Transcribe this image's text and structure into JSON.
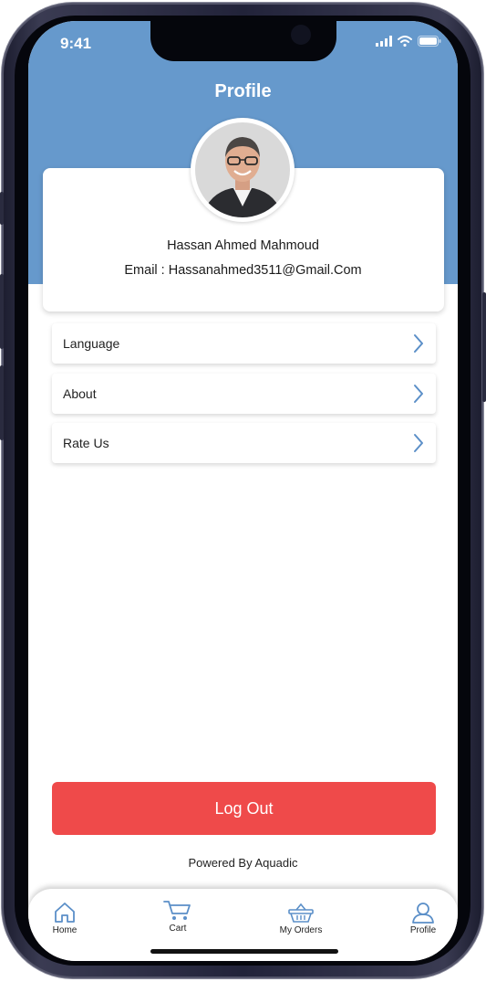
{
  "status_bar": {
    "time": "9:41"
  },
  "header": {
    "title": "Profile"
  },
  "profile": {
    "name": "Hassan Ahmed Mahmoud",
    "email_line": "Email : Hassanahmed3511@Gmail.Com"
  },
  "menu": [
    {
      "label": "Language",
      "icon": "chevron-right-icon"
    },
    {
      "label": "About",
      "icon": "chevron-right-icon"
    },
    {
      "label": "Rate Us",
      "icon": "chevron-right-icon"
    }
  ],
  "logout_label": "Log Out",
  "footer_text": "Powered By Aquadic",
  "bottom_nav": [
    {
      "label": "Home",
      "icon": "home-icon"
    },
    {
      "label": "Cart",
      "icon": "cart-icon"
    },
    {
      "label": "My Orders",
      "icon": "basket-icon"
    },
    {
      "label": "Profile",
      "icon": "user-icon"
    }
  ],
  "colors": {
    "header_blue": "#6699CC",
    "logout_red": "#EF4A4A",
    "icon_blue": "#5B8FC8"
  }
}
